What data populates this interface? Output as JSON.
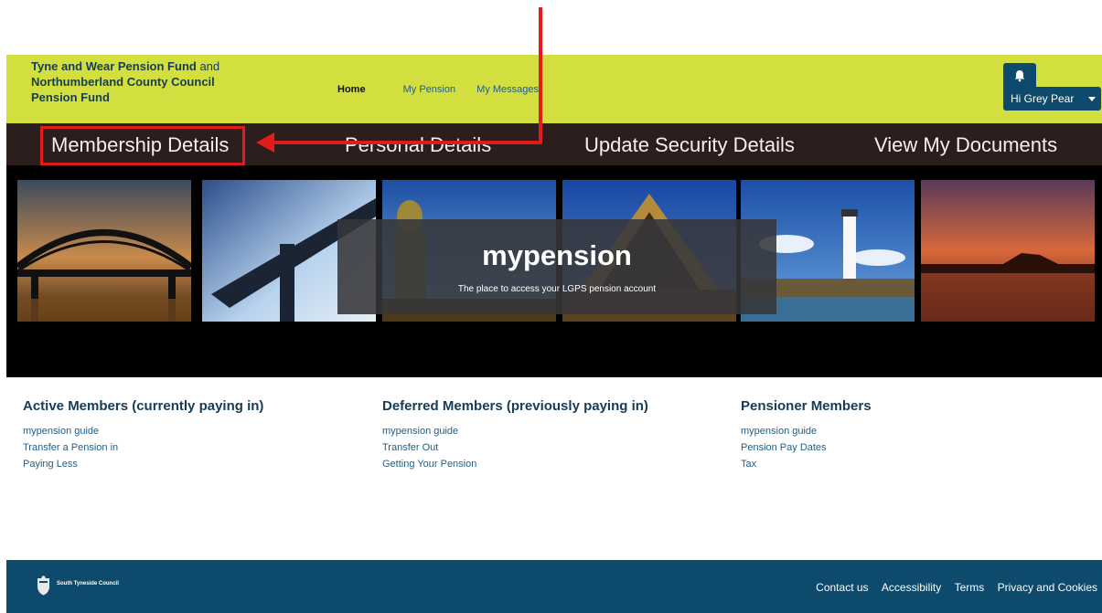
{
  "header": {
    "org_bold_1": "Tyne and Wear Pension Fund",
    "org_plain": " and",
    "org_bold_2": "Northumberland County Council",
    "org_bold_3": "Pension Fund",
    "nav": [
      {
        "label": "Home",
        "active": true
      },
      {
        "label": "My Pension",
        "active": false
      },
      {
        "label": "My Messages",
        "active": false
      }
    ],
    "bell_icon": "bell-icon",
    "user_label": "Hi Grey Pear"
  },
  "secondary_nav": [
    {
      "label": "Membership Details"
    },
    {
      "label": "Personal Details"
    },
    {
      "label": "Update Security Details"
    },
    {
      "label": "View My Documents"
    }
  ],
  "hero": {
    "title": "mypension",
    "subtitle": "The place to access your LGPS pension account"
  },
  "columns": [
    {
      "heading": "Active Members (currently paying in)",
      "links": [
        "mypension guide",
        "Transfer a Pension in",
        "Paying Less"
      ]
    },
    {
      "heading": "Deferred Members (previously paying in)",
      "links": [
        "mypension guide",
        "Transfer Out",
        "Getting Your Pension"
      ]
    },
    {
      "heading": "Pensioner Members",
      "links": [
        "mypension guide",
        "Pension Pay Dates",
        "Tax"
      ]
    }
  ],
  "footer": {
    "council": "South Tyneside Council",
    "links": [
      "Contact us",
      "Accessibility",
      "Terms",
      "Privacy and Cookies"
    ]
  },
  "colors": {
    "header_bg": "#d3df3e",
    "secnav_bg": "#2b1e1c",
    "brand_blue": "#0d4a6b",
    "annotation_red": "#e31a1c"
  }
}
